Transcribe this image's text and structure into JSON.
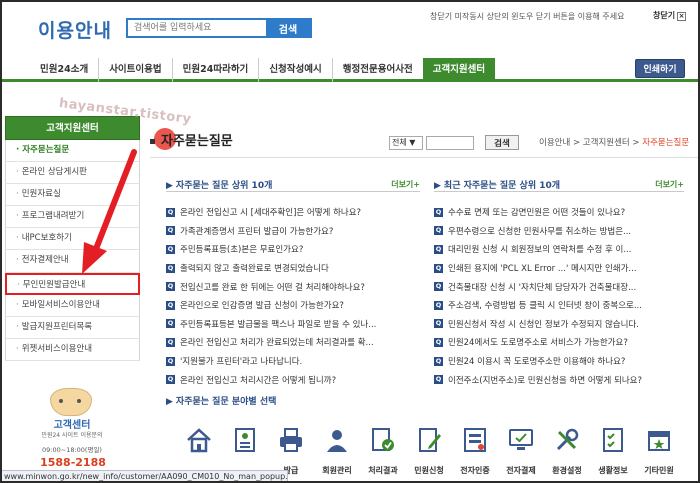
{
  "header": {
    "logo": "이용안내",
    "search_placeholder": "검색어를 입력하세요",
    "search_button": "검색",
    "notice": "창닫기 미작동시 상단의 윈도우 닫기 버튼을 이용해 주세요",
    "close_label": "창닫기",
    "close_glyph": "×"
  },
  "nav": {
    "tabs": [
      "민원24소개",
      "사이트이용법",
      "민원24따라하기",
      "신청작성예시",
      "행정전문용어사전",
      "고객지원센터"
    ],
    "print_label": "인쇄하기"
  },
  "watermark": "hayanstar.tistory",
  "sidebar": {
    "header": "고객지원센터",
    "items": [
      "자주묻는질문",
      "온라인 상담게시판",
      "민원자료실",
      "프로그램내려받기",
      "내PC보호하기",
      "전자결제안내",
      "무인민원발급안내",
      "모바일서비스이용안내",
      "발급지원프린터목록",
      "위젯서비스이용안내"
    ],
    "selected_index": 0,
    "highlighted_index": 6
  },
  "help": {
    "title": "고객센터",
    "subtitle": "민원24 사이트 이용문의",
    "hours": "09:00~18:00(평일)",
    "phone": "1588-2188"
  },
  "statusbar": "www.minwon.go.kr/new_info/customer/AA090_CM010_No_man_popup.jsp",
  "main": {
    "title": "자주묻는질문",
    "filter_select": "전체 ▼",
    "filter_button": "검색",
    "breadcrumb_prefix": "이용안내 > 고객지원센터 > ",
    "breadcrumb_current": "자주묻는질문"
  },
  "faq_left": {
    "heading": "자주묻는 질문 상위 10개",
    "more": "더보기+",
    "badge": "Q",
    "items": [
      "온라인 전입신고 시 [세대주확인]은 어떻게 하나요?",
      "가족관계증명서 프린터 발급이 가능한가요?",
      "주민등록표등(초)본은 무료인가요?",
      "출력되지 않고 출력완료로 변경되었습니다",
      "전입신고를 완료 한 뒤에는 어떤 걸 처리해야하나요?",
      "온라인으로 인감증명 발급 신청이 가능한가요?",
      "주민등록표등본 발급물을 팩스나 파일로 받을 수 있나...",
      "온라인 전입신고 처리가 완료되었는데 처리결과를 확...",
      "'지원불가 프린터'라고 나타납니다.",
      "온라인 전입신고 처리시간은 어떻게 됩니까?"
    ]
  },
  "faq_right": {
    "heading": "최근 자주묻는 질문 상위 10개",
    "more": "더보기+",
    "badge": "Q",
    "items": [
      "수수료 면제 또는 감면민원은 어떤 것들이 있나요?",
      "우편수령으로 신청한 민원사무를 취소하는 방법은...",
      "대리민원 신청 시 회원정보의 연락처를 수정 후 이...",
      "인쇄된 용지에 'PCL XL Error ...' 메시지만 인쇄가...",
      "건축물대장 신청 시 '자치단체 담당자가 건축물대장...",
      "주소검색, 수령방법 등 클릭 시 인터넷 창이 중복으로...",
      "민원신청서 작성 시 신청인 정보가 수정되지 않습니다.",
      "민원24에서도 도로명주소로 서비스가 가능한가요?",
      "민원24 이용시 꼭 도로명주소만 이용해야 하나요?",
      "이전주소(지번주소)로 민원신청을 하면 어떻게 되나요?"
    ]
  },
  "categories": {
    "heading": "자주묻는 질문 분야별 선택",
    "items": [
      {
        "label": "",
        "icon": "house-icon"
      },
      {
        "label": "",
        "icon": "certificate-icon"
      },
      {
        "label": "발급",
        "icon": "printer-icon"
      },
      {
        "label": "회원관리",
        "icon": "member-icon"
      },
      {
        "label": "처리결과",
        "icon": "result-icon"
      },
      {
        "label": "민원신청",
        "icon": "application-icon"
      },
      {
        "label": "전자인증",
        "icon": "cert-auth-icon"
      },
      {
        "label": "전자결제",
        "icon": "monitor-icon"
      },
      {
        "label": "환경설정",
        "icon": "tools-icon"
      },
      {
        "label": "생활정보",
        "icon": "checklist-icon"
      },
      {
        "label": "기타민원",
        "icon": "misc-icon"
      }
    ]
  },
  "colors": {
    "brand_green": "#3e8a2f",
    "brand_blue": "#2f6ab3",
    "highlight_red": "#e31e24"
  }
}
